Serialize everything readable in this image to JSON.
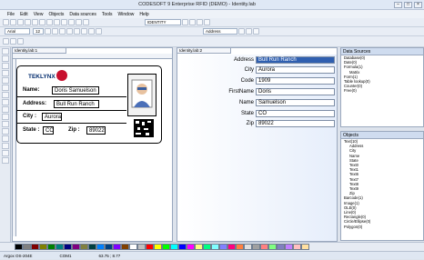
{
  "window": {
    "title": "CODESOFT 9 Enterprise RFID (DEMO) - Identity.lab"
  },
  "menu": [
    "File",
    "Edit",
    "View",
    "Objects",
    "Data sources",
    "Tools",
    "Window",
    "Help"
  ],
  "toolbar": {
    "font_name": "Arial",
    "font_size": "12",
    "printer_combo": "IDENTITY",
    "size_combo": "Address"
  },
  "doc_tab": "Identity.lab:1",
  "db_tab": "Identity.lab:2",
  "label": {
    "logo_text": "TEKLYNX",
    "name_label": "Name:",
    "name_value": "Doris Samuelson",
    "address_label": "Address:",
    "address_value": "Bull Run Ranch",
    "city_label": "City :",
    "city_value": "Aurora",
    "state_label": "State :",
    "state_value": "CO",
    "zip_label": "Zip :",
    "zip_value": "89022"
  },
  "form": {
    "rows": [
      {
        "label": "Address",
        "value": "Bull Run Ranch",
        "selected": true
      },
      {
        "label": "City",
        "value": "Aurora"
      },
      {
        "label": "Code",
        "value": "1909"
      },
      {
        "label": "FirstName",
        "value": "Doris"
      },
      {
        "label": "Name",
        "value": "Samuelson"
      },
      {
        "label": "State",
        "value": "CO"
      },
      {
        "label": "Zip",
        "value": "89022"
      }
    ]
  },
  "data_sources": {
    "title": "Data Sources",
    "items": [
      "Database(0)",
      "Date(0)",
      "Formula(1)",
      "Matrix",
      "Form(1)",
      "Table lookup(0)",
      "Counter(0)",
      "Free(0)"
    ]
  },
  "objects": {
    "title": "Objects",
    "items": [
      "Text(10)",
      "Address",
      "City",
      "Name",
      "State",
      "Text0",
      "Text1",
      "Text6",
      "Text7",
      "Text8",
      "Text9",
      "Zip",
      "Barcode(1)",
      "Image(1)",
      "OLE(0)",
      "Line(0)",
      "Rectangle(0)",
      "Circle/Ellipse(0)",
      "Polygon(0)"
    ]
  },
  "colors": [
    "#000000",
    "#808080",
    "#800000",
    "#808000",
    "#008000",
    "#008080",
    "#000080",
    "#800080",
    "#808040",
    "#004040",
    "#0080ff",
    "#004080",
    "#8000ff",
    "#804000",
    "#ffffff",
    "#c0c0c0",
    "#ff0000",
    "#ffff00",
    "#00ff00",
    "#00ffff",
    "#0000ff",
    "#ff00ff",
    "#ffff80",
    "#00ff80",
    "#80ffff",
    "#8080ff",
    "#ff0080",
    "#ff8040",
    "#e0e0e0",
    "#a0a0a0",
    "#ff8080",
    "#80ff80",
    "#8080c0",
    "#c080ff",
    "#ffc0c0",
    "#ffe0a0"
  ],
  "status": {
    "printer": "Argox OS-204E",
    "port": "COM1",
    "coords": "63.75 ; 8.77"
  }
}
